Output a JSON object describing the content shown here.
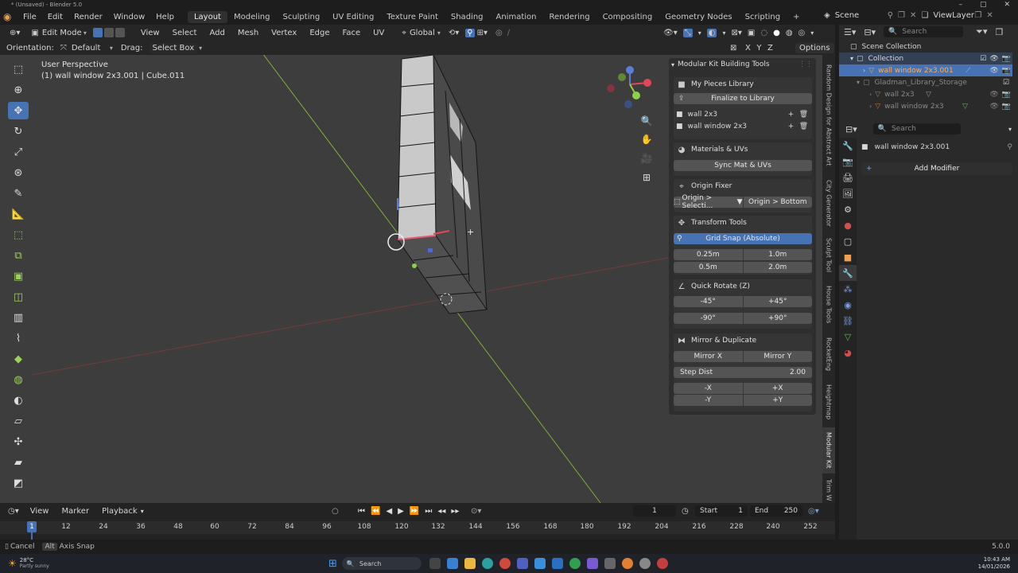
{
  "window": {
    "title": "* (Unsaved) - Blender 5.0",
    "controls": [
      "–",
      "▢",
      "✕"
    ]
  },
  "menu": [
    "File",
    "Edit",
    "Render",
    "Window",
    "Help"
  ],
  "workspaces": [
    "Layout",
    "Modeling",
    "Sculpting",
    "UV Editing",
    "Texture Paint",
    "Shading",
    "Animation",
    "Rendering",
    "Compositing",
    "Geometry Nodes",
    "Scripting"
  ],
  "workspace_add": "+",
  "scene": {
    "name": "Scene",
    "view_layer": "ViewLayer"
  },
  "viewport_header": {
    "mode": "Edit Mode",
    "menus": [
      "View",
      "Select",
      "Add",
      "Mesh",
      "Vertex",
      "Edge",
      "Face",
      "UV"
    ],
    "transform": "Global"
  },
  "tool_settings": {
    "orientation_label": "Orientation:",
    "orientation_value": "Default",
    "drag_label": "Drag:",
    "drag_value": "Select Box",
    "axes": [
      "X",
      "Y",
      "Z"
    ],
    "options": "Options"
  },
  "overlay_text": {
    "perspective": "User Perspective",
    "object": "(1) wall window 2x3.001 | Cube.011"
  },
  "npanel": {
    "header": "Modular Kit Building Tools",
    "library": {
      "title": "My Pieces Library",
      "finalize": "Finalize to Library",
      "items": [
        "wall 2x3",
        "wall window 2x3"
      ]
    },
    "materials": {
      "title": "Materials & UVs",
      "sync": "Sync Mat & UVs"
    },
    "origin": {
      "title": "Origin Fixer",
      "a": "Origin > Selecti...",
      "b": "Origin > Bottom"
    },
    "transform": {
      "title": "Transform Tools",
      "grid": "Grid Snap (Absolute)",
      "values": [
        "0.25m",
        "1.0m",
        "0.5m",
        "2.0m"
      ]
    },
    "rotate": {
      "title": "Quick Rotate (Z)",
      "values": [
        "-45°",
        "+45°",
        "-90°",
        "+90°"
      ]
    },
    "mirror": {
      "title": "Mirror & Duplicate",
      "mx": "Mirror X",
      "my": "Mirror Y",
      "step_label": "Step Dist",
      "step_value": "2.00",
      "moves": [
        "-X",
        "+X",
        "-Y",
        "+Y"
      ]
    }
  },
  "side_tabs": [
    "Random Design for Abstract Art",
    "City Generator",
    "Sculpt Tool",
    "House Tools",
    "RocketEng",
    "Heightmap",
    "Modular Kit",
    "Trim W"
  ],
  "outliner": {
    "search_placeholder": "Search",
    "rows": [
      "Scene Collection",
      "Collection",
      "wall window 2x3.001",
      "Gladman_Library_Storage",
      "wall 2x3",
      "wall window 2x3"
    ]
  },
  "properties": {
    "search_placeholder": "Search",
    "object": "wall window 2x3.001",
    "add_modifier": "Add Modifier"
  },
  "timeline": {
    "menus": [
      "View",
      "Marker",
      "Playback"
    ],
    "current_frame": "1",
    "start_label": "Start",
    "start": "1",
    "end_label": "End",
    "end": "250",
    "ruler": [
      "1",
      "12",
      "24",
      "36",
      "48",
      "60",
      "72",
      "84",
      "96",
      "108",
      "120",
      "132",
      "144",
      "156",
      "168",
      "180",
      "192",
      "204",
      "216",
      "228",
      "240",
      "252"
    ]
  },
  "status": {
    "cancel": "Cancel",
    "alt": "Alt",
    "axis_snap": "Axis Snap",
    "version": "5.0.0"
  },
  "taskbar": {
    "weather_temp": "28°C",
    "weather_desc": "Partly sunny",
    "search": "Search",
    "time": "10:43 AM",
    "date": "14/01/2026"
  }
}
